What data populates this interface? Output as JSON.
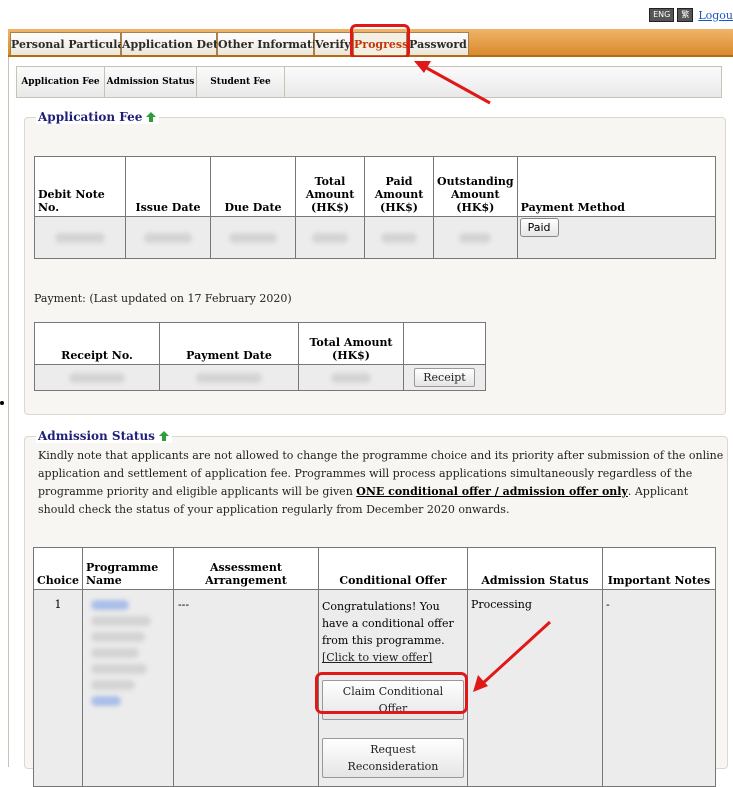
{
  "header": {
    "lang_eng": "ENG",
    "lang_chi": "繁",
    "logout": "Logou"
  },
  "main_tabs": [
    {
      "label": "Personal Particulars"
    },
    {
      "label": "Application Details"
    },
    {
      "label": "Other Information"
    },
    {
      "label": "Verify"
    },
    {
      "label": "Progress",
      "active": true
    },
    {
      "label": "Password"
    }
  ],
  "sub_tabs": [
    {
      "label": "Application Fee"
    },
    {
      "label": "Admission Status"
    },
    {
      "label": "Student Fee"
    }
  ],
  "application_fee": {
    "title": "Application Fee",
    "columns": [
      "Debit Note No.",
      "Issue Date",
      "Due Date",
      "Total Amount (HK$)",
      "Paid Amount (HK$)",
      "Outstanding Amount (HK$)",
      "Payment Method"
    ],
    "payment_button": "Paid",
    "payment_note": "Payment: (Last updated on 17 February 2020)",
    "receipt_columns": [
      "Receipt No.",
      "Payment Date",
      "Total Amount (HK$)",
      ""
    ],
    "receipt_button": "Receipt"
  },
  "admission_status": {
    "title": "Admission Status",
    "note_part1": "Kindly note that applicants are not allowed to change the programme choice and its priority after submission of the online application and settlement of application fee. Programmes will process applications simultaneously regardless of the programme priority and eligible applicants will be given ",
    "note_bold": "ONE conditional offer / admission offer only",
    "note_part2": ". Applicant should check the status of your application regularly from December 2020 onwards.",
    "columns": [
      "Choice",
      "Programme Name",
      "Assessment Arrangement",
      "Conditional Offer",
      "Admission Status",
      "Important Notes"
    ],
    "row": {
      "choice": "1",
      "assessment": "---",
      "offer_text": "Congratulations! You have a conditional offer from this programme.",
      "offer_link": "[Click to view offer]",
      "claim_button": "Claim Conditional Offer",
      "reconsider_button": "Request Reconsideration",
      "status": "Processing",
      "notes": "-"
    }
  },
  "colors": {
    "tab_bar": "#e09a45",
    "active_tab_text": "#c2380a",
    "legend_text": "#1d1f7a",
    "highlight": "#e01818",
    "arrow_icon": "#2e9e3a"
  }
}
